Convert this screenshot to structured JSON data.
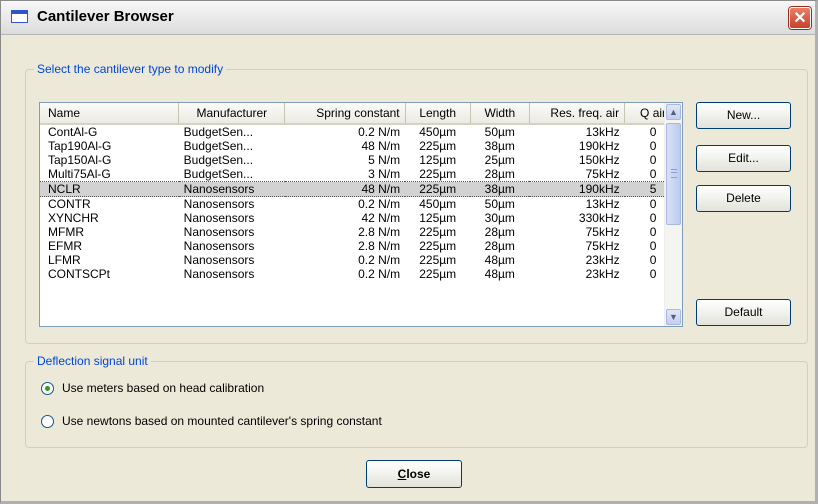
{
  "window": {
    "title": "Cantilever Browser",
    "close_glyph": "✕"
  },
  "cantilever_group": {
    "legend": "Select the cantilever type to modify"
  },
  "table": {
    "columns": [
      "Name",
      "Manufacturer",
      "Spring constant",
      "Length",
      "Width",
      "Res. freq. air",
      "Q air"
    ],
    "rows": [
      [
        "ContAl-G",
        "BudgetSen...",
        "0.2 N/m",
        "450µm",
        "50µm",
        "13kHz",
        "0"
      ],
      [
        "Tap190Al-G",
        "BudgetSen...",
        "48 N/m",
        "225µm",
        "38µm",
        "190kHz",
        "0"
      ],
      [
        "Tap150Al-G",
        "BudgetSen...",
        "5 N/m",
        "125µm",
        "25µm",
        "150kHz",
        "0"
      ],
      [
        "Multi75Al-G",
        "BudgetSen...",
        "3 N/m",
        "225µm",
        "28µm",
        "75kHz",
        "0"
      ],
      [
        "NCLR",
        "Nanosensors",
        "48 N/m",
        "225µm",
        "38µm",
        "190kHz",
        "5"
      ],
      [
        "CONTR",
        "Nanosensors",
        "0.2 N/m",
        "450µm",
        "50µm",
        "13kHz",
        "0"
      ],
      [
        "XYNCHR",
        "Nanosensors",
        "42 N/m",
        "125µm",
        "30µm",
        "330kHz",
        "0"
      ],
      [
        "MFMR",
        "Nanosensors",
        "2.8 N/m",
        "225µm",
        "28µm",
        "75kHz",
        "0"
      ],
      [
        "EFMR",
        "Nanosensors",
        "2.8 N/m",
        "225µm",
        "28µm",
        "75kHz",
        "0"
      ],
      [
        "LFMR",
        "Nanosensors",
        "0.2 N/m",
        "225µm",
        "48µm",
        "23kHz",
        "0"
      ],
      [
        "CONTSCPt",
        "Nanosensors",
        "0.2 N/m",
        "225µm",
        "48µm",
        "23kHz",
        "0"
      ]
    ],
    "selected_row": 4
  },
  "buttons": {
    "new": "New...",
    "edit": "Edit...",
    "delete": "Delete",
    "default": "Default",
    "close": "Close"
  },
  "deflection_group": {
    "legend": "Deflection signal unit",
    "options": [
      {
        "label": "Use meters based on head calibration",
        "selected": true
      },
      {
        "label": "Use newtons based on mounted cantilever's spring constant",
        "selected": false
      }
    ]
  },
  "icons": [
    "window-icon",
    "close-icon",
    "scroll-up-icon",
    "scroll-down-icon",
    "scroll-grip-icon"
  ],
  "colors": {
    "legend_text": "#0046d5",
    "selection": "#d2d2d2",
    "radio_dot": "#21a121",
    "close_button": "#c8412a"
  }
}
